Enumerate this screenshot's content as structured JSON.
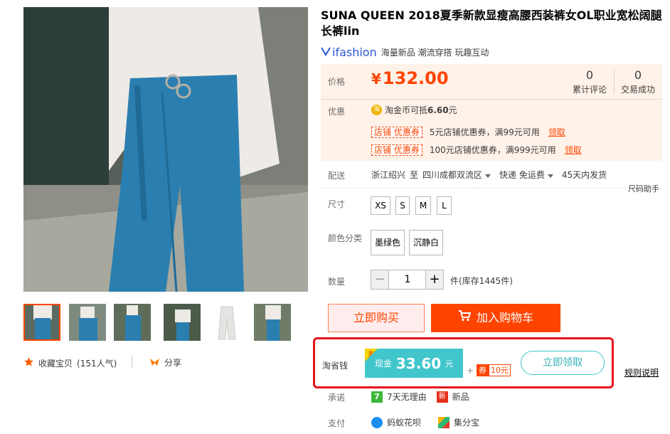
{
  "product": {
    "title": "SUNA QUEEN 2018夏季新款显瘦高腰西装裤女OL职业宽松阔腿长裤lin",
    "brand": {
      "logo_text": "ifashion",
      "tags": "海量新品 潮流穿搭 玩趣互动"
    }
  },
  "gallery": {
    "thumb_count": 6,
    "active_index": 0,
    "favorite_label": "收藏宝贝",
    "favorite_count": "(151人气)",
    "share_label": "分享"
  },
  "price": {
    "label": "价格",
    "currency": "¥",
    "value": "132.00",
    "review_count": "0",
    "review_label": "累计评论",
    "sales_count": "0",
    "sales_label": "交易成功"
  },
  "promo": {
    "label": "优惠",
    "coin_icon_text": "淘",
    "coin_text": "淘金币可抵",
    "coin_value": "6.60",
    "coin_unit": "元",
    "coupons": [
      {
        "tag": "店铺 优惠券",
        "text": "5元店铺优惠券，满99元可用",
        "link": "领取"
      },
      {
        "tag": "店铺 优惠券",
        "text": "100元店铺优惠券，满999元可用",
        "link": "领取"
      }
    ]
  },
  "shipping": {
    "label": "配送",
    "from": "浙江绍兴",
    "to_word": "至",
    "destination": "四川成都双流区",
    "method": "快递 免运费",
    "dispatch": "45天内发货",
    "size_helper": "尺码助手"
  },
  "options": {
    "size_label": "尺寸",
    "sizes": [
      "XS",
      "S",
      "M",
      "L"
    ],
    "color_label": "颜色分类",
    "colors": [
      "墨绿色",
      "沉静白"
    ]
  },
  "quantity": {
    "label": "数量",
    "minus": "−",
    "value": "1",
    "plus": "+",
    "stock_text": "件(库存1445件)"
  },
  "actions": {
    "buy_now": "立即购买",
    "add_to_cart": "加入购物车"
  },
  "savings": {
    "label": "淘省钱",
    "badge": "淘",
    "cash_label": "现金",
    "cash_value": "33.60",
    "cash_unit": "元",
    "plus": "+",
    "voucher_tag": "券",
    "voucher_value": "10元",
    "claim_button": "立即领取",
    "rules_link": "规则说明"
  },
  "promise": {
    "label": "承诺",
    "icon1": "7",
    "text1": "7天无理由",
    "icon2": "新",
    "text2": "新品"
  },
  "payment": {
    "label": "支付",
    "method1": "蚂蚁花呗",
    "method2": "集分宝"
  },
  "colors": {
    "accent": "#ff4400",
    "price_bg": "#fff2e8",
    "cash_teal": "#41c6cc",
    "highlight_red": "#e5151b",
    "brand_blue": "#2a57d6"
  }
}
